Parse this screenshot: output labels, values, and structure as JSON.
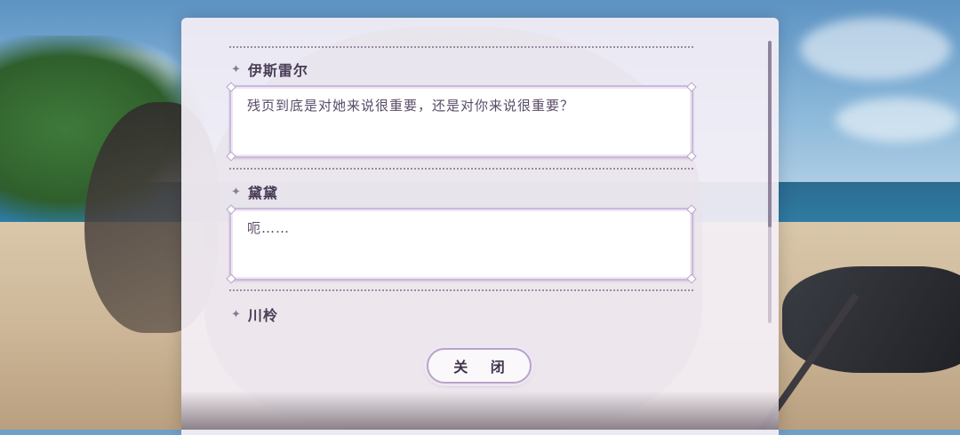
{
  "dialog_log": {
    "entries": [
      {
        "speaker": "伊斯雷尔",
        "text": "残页到底是对她来说很重要，还是对你来说很重要？"
      },
      {
        "speaker": "黛黛",
        "text": "呃……"
      },
      {
        "speaker": "川柃",
        "text": ""
      }
    ],
    "close_label": "关 闭"
  },
  "icons": {
    "speaker_marker": "four-point-star-icon"
  },
  "colors": {
    "panel_bg": "#f4eff6",
    "accent_purple": "#b9a3c7",
    "speaker_text": "#4a3d57",
    "dialog_text": "#5a4b66"
  }
}
